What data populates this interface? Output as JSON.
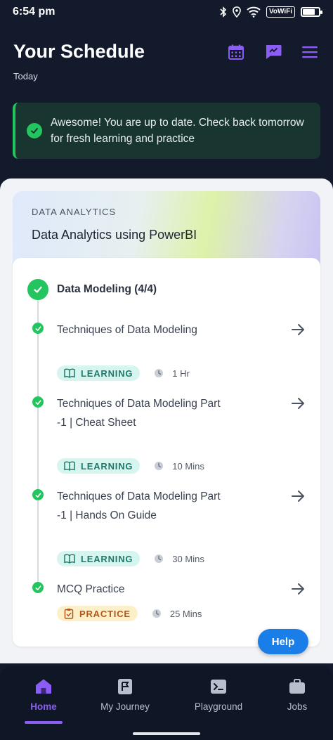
{
  "status_bar": {
    "time": "6:54 pm",
    "network_label": "VoWiFi"
  },
  "header": {
    "title": "Your Schedule",
    "subtitle": "Today",
    "icons": [
      "calendar-icon",
      "chat-icon",
      "menu-icon"
    ]
  },
  "banner": {
    "message": "Awesome! You are up to date. Check back tomorrow for fresh learning and practice"
  },
  "course": {
    "category": "DATA ANALYTICS",
    "name": "Data Analytics using PowerBI"
  },
  "section": {
    "title": "Data Modeling (4/4)"
  },
  "items": [
    {
      "title": "Techniques of Data Modeling",
      "type": "LEARNING",
      "duration": "1 Hr"
    },
    {
      "title": "Techniques of Data Modeling Part -1 | Cheat Sheet",
      "type": "LEARNING",
      "duration": "10 Mins"
    },
    {
      "title": "Techniques of Data Modeling Part -1 | Hands On Guide",
      "type": "LEARNING",
      "duration": "30 Mins"
    },
    {
      "title": "MCQ Practice",
      "type": "PRACTICE",
      "duration": "25 Mins"
    }
  ],
  "help": {
    "label": "Help"
  },
  "nav": [
    {
      "label": "Home",
      "active": true
    },
    {
      "label": "My Journey"
    },
    {
      "label": "Playground"
    },
    {
      "label": "Jobs"
    }
  ],
  "colors": {
    "accent": "#8b5cf6",
    "success": "#22c55e",
    "help_blue": "#1a7ee8"
  }
}
